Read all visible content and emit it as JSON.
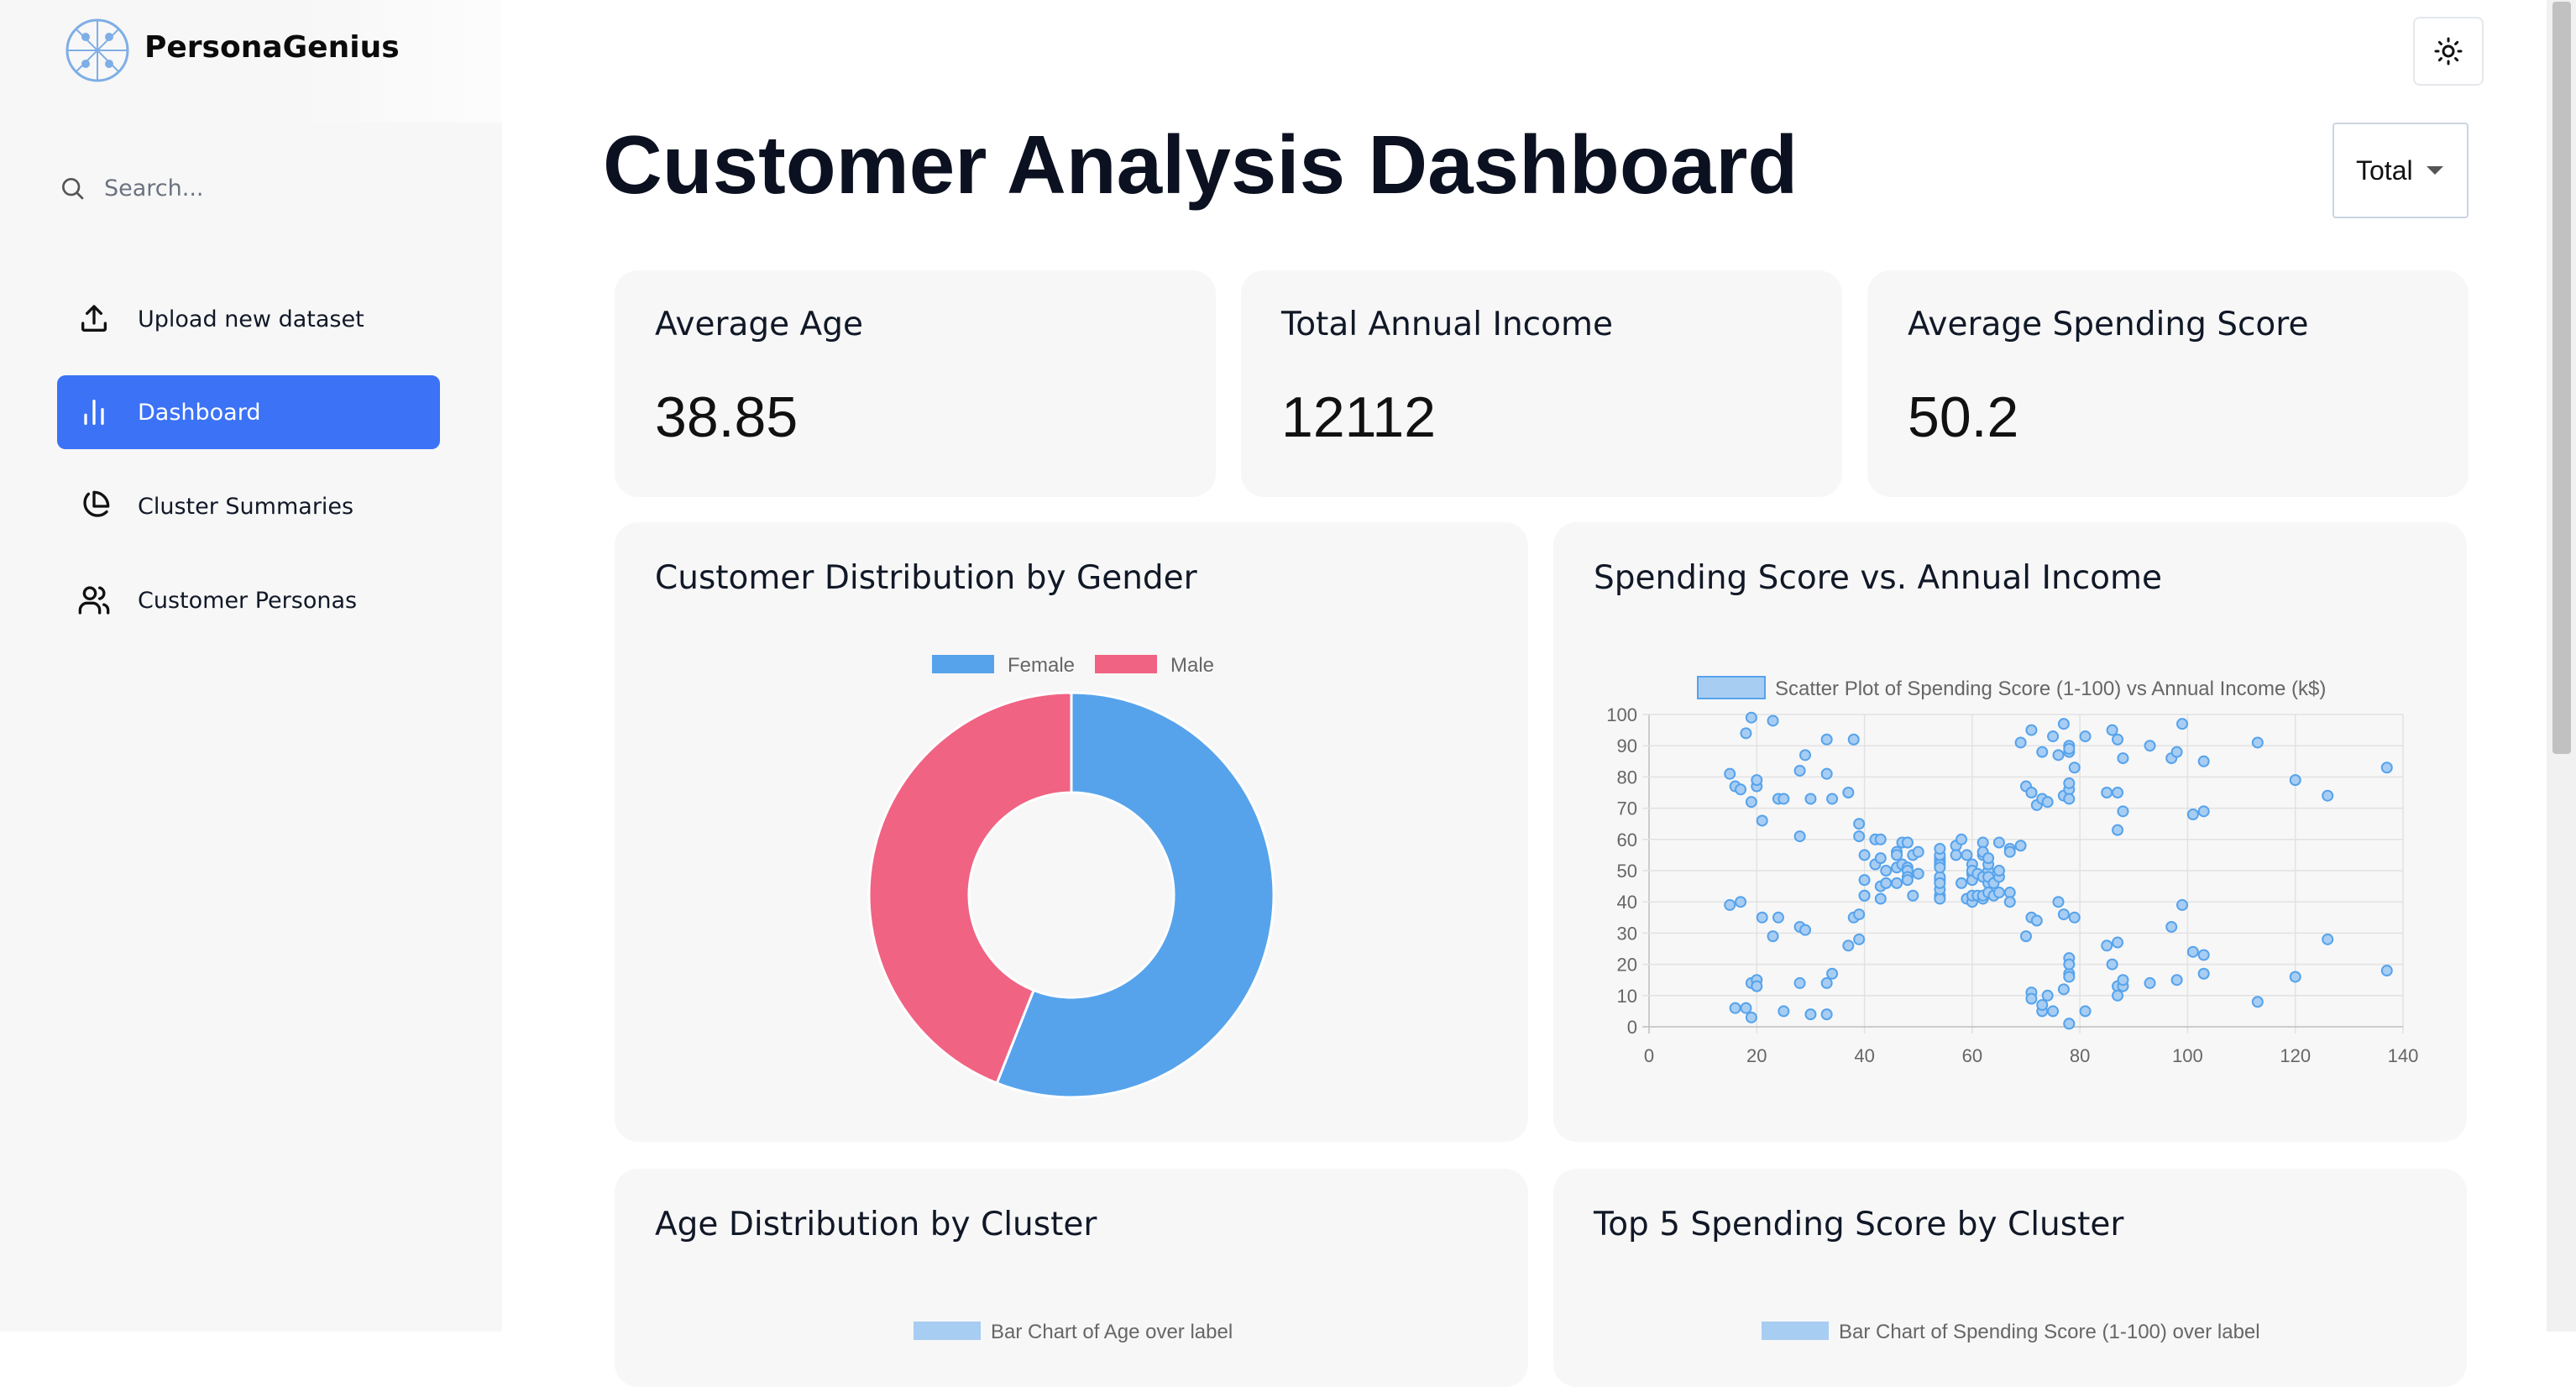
{
  "app": {
    "brand": "PersonaGenius"
  },
  "search": {
    "placeholder": "Search..."
  },
  "sidebar": {
    "items": [
      {
        "label": "Upload new dataset",
        "icon": "upload-icon"
      },
      {
        "label": "Dashboard",
        "icon": "bar-chart-icon",
        "active": true
      },
      {
        "label": "Cluster Summaries",
        "icon": "pie-chart-icon"
      },
      {
        "label": "Customer Personas",
        "icon": "users-icon"
      }
    ]
  },
  "header": {
    "title": "Customer Analysis Dashboard",
    "filter_value": "Total",
    "theme_icon": "sun-icon"
  },
  "stats": [
    {
      "title": "Average Age",
      "value": "38.85"
    },
    {
      "title": "Total Annual Income",
      "value": "12112"
    },
    {
      "title": "Average Spending Score",
      "value": "50.2"
    }
  ],
  "colors": {
    "accent": "#3b72f6",
    "female": "#56a3ec",
    "male": "#f06383",
    "card": "#f7f7f7"
  },
  "cards": {
    "gender": {
      "title": "Customer Distribution by Gender"
    },
    "scatter": {
      "title": "Spending Score vs. Annual Income"
    },
    "age": {
      "title": "Age Distribution by Cluster",
      "legend": "Bar Chart of Age over label"
    },
    "spending": {
      "title": "Top 5 Spending Score by Cluster",
      "legend": "Bar Chart of Spending Score (1-100) over label"
    }
  },
  "chart_data": [
    {
      "type": "pie",
      "variant": "doughnut",
      "categories": [
        "Female",
        "Male"
      ],
      "values": [
        112,
        88
      ],
      "legend": "top"
    },
    {
      "type": "scatter",
      "series": [
        {
          "name": "Scatter Plot of Spending Score (1-100) vs Annual Income (k$)",
          "points": [
            [
              15,
              39
            ],
            [
              15,
              81
            ],
            [
              16,
              6
            ],
            [
              16,
              77
            ],
            [
              17,
              40
            ],
            [
              17,
              76
            ],
            [
              18,
              6
            ],
            [
              18,
              94
            ],
            [
              19,
              3
            ],
            [
              19,
              72
            ],
            [
              19,
              14
            ],
            [
              19,
              99
            ],
            [
              20,
              15
            ],
            [
              20,
              77
            ],
            [
              20,
              13
            ],
            [
              20,
              79
            ],
            [
              21,
              35
            ],
            [
              21,
              66
            ],
            [
              23,
              29
            ],
            [
              23,
              98
            ],
            [
              24,
              35
            ],
            [
              24,
              73
            ],
            [
              25,
              5
            ],
            [
              25,
              73
            ],
            [
              28,
              14
            ],
            [
              28,
              82
            ],
            [
              28,
              32
            ],
            [
              28,
              61
            ],
            [
              29,
              31
            ],
            [
              29,
              87
            ],
            [
              30,
              4
            ],
            [
              30,
              73
            ],
            [
              33,
              4
            ],
            [
              33,
              92
            ],
            [
              33,
              14
            ],
            [
              33,
              81
            ],
            [
              34,
              17
            ],
            [
              34,
              73
            ],
            [
              37,
              26
            ],
            [
              37,
              75
            ],
            [
              38,
              35
            ],
            [
              38,
              92
            ],
            [
              39,
              36
            ],
            [
              39,
              61
            ],
            [
              39,
              28
            ],
            [
              39,
              65
            ],
            [
              40,
              55
            ],
            [
              40,
              47
            ],
            [
              40,
              42
            ],
            [
              40,
              42
            ],
            [
              42,
              52
            ],
            [
              42,
              60
            ],
            [
              43,
              54
            ],
            [
              43,
              60
            ],
            [
              43,
              45
            ],
            [
              43,
              41
            ],
            [
              44,
              50
            ],
            [
              44,
              46
            ],
            [
              46,
              51
            ],
            [
              46,
              46
            ],
            [
              46,
              56
            ],
            [
              46,
              55
            ],
            [
              47,
              52
            ],
            [
              47,
              59
            ],
            [
              48,
              51
            ],
            [
              48,
              59
            ],
            [
              48,
              50
            ],
            [
              48,
              48
            ],
            [
              48,
              59
            ],
            [
              48,
              47
            ],
            [
              49,
              55
            ],
            [
              49,
              42
            ],
            [
              50,
              49
            ],
            [
              50,
              56
            ],
            [
              54,
              47
            ],
            [
              54,
              54
            ],
            [
              54,
              53
            ],
            [
              54,
              48
            ],
            [
              54,
              52
            ],
            [
              54,
              42
            ],
            [
              54,
              51
            ],
            [
              54,
              55
            ],
            [
              54,
              41
            ],
            [
              54,
              44
            ],
            [
              54,
              57
            ],
            [
              54,
              46
            ],
            [
              57,
              58
            ],
            [
              57,
              55
            ],
            [
              58,
              60
            ],
            [
              58,
              46
            ],
            [
              59,
              55
            ],
            [
              59,
              41
            ],
            [
              60,
              49
            ],
            [
              60,
              40
            ],
            [
              60,
              42
            ],
            [
              60,
              52
            ],
            [
              60,
              47
            ],
            [
              60,
              50
            ],
            [
              61,
              42
            ],
            [
              61,
              49
            ],
            [
              62,
              41
            ],
            [
              62,
              48
            ],
            [
              62,
              59
            ],
            [
              62,
              55
            ],
            [
              62,
              56
            ],
            [
              62,
              42
            ],
            [
              63,
              50
            ],
            [
              63,
              46
            ],
            [
              63,
              43
            ],
            [
              63,
              48
            ],
            [
              63,
              52
            ],
            [
              63,
              54
            ],
            [
              64,
              42
            ],
            [
              64,
              46
            ],
            [
              65,
              48
            ],
            [
              65,
              50
            ],
            [
              65,
              43
            ],
            [
              65,
              59
            ],
            [
              67,
              43
            ],
            [
              67,
              57
            ],
            [
              67,
              56
            ],
            [
              67,
              40
            ],
            [
              69,
              58
            ],
            [
              69,
              91
            ],
            [
              70,
              29
            ],
            [
              70,
              77
            ],
            [
              71,
              35
            ],
            [
              71,
              95
            ],
            [
              71,
              11
            ],
            [
              71,
              75
            ],
            [
              71,
              9
            ],
            [
              71,
              75
            ],
            [
              72,
              34
            ],
            [
              72,
              71
            ],
            [
              73,
              5
            ],
            [
              73,
              88
            ],
            [
              73,
              7
            ],
            [
              73,
              73
            ],
            [
              74,
              10
            ],
            [
              74,
              72
            ],
            [
              75,
              5
            ],
            [
              75,
              93
            ],
            [
              76,
              40
            ],
            [
              76,
              87
            ],
            [
              77,
              12
            ],
            [
              77,
              97
            ],
            [
              77,
              36
            ],
            [
              77,
              74
            ],
            [
              78,
              22
            ],
            [
              78,
              90
            ],
            [
              78,
              17
            ],
            [
              78,
              88
            ],
            [
              78,
              20
            ],
            [
              78,
              76
            ],
            [
              78,
              16
            ],
            [
              78,
              89
            ],
            [
              78,
              1
            ],
            [
              78,
              78
            ],
            [
              78,
              1
            ],
            [
              78,
              73
            ],
            [
              79,
              35
            ],
            [
              79,
              83
            ],
            [
              81,
              5
            ],
            [
              81,
              93
            ],
            [
              85,
              26
            ],
            [
              85,
              75
            ],
            [
              86,
              20
            ],
            [
              86,
              95
            ],
            [
              87,
              27
            ],
            [
              87,
              63
            ],
            [
              87,
              13
            ],
            [
              87,
              75
            ],
            [
              87,
              10
            ],
            [
              87,
              92
            ],
            [
              88,
              13
            ],
            [
              88,
              86
            ],
            [
              88,
              15
            ],
            [
              88,
              69
            ],
            [
              93,
              14
            ],
            [
              93,
              90
            ],
            [
              97,
              32
            ],
            [
              97,
              86
            ],
            [
              98,
              15
            ],
            [
              98,
              88
            ],
            [
              99,
              39
            ],
            [
              99,
              97
            ],
            [
              101,
              24
            ],
            [
              101,
              68
            ],
            [
              103,
              17
            ],
            [
              103,
              85
            ],
            [
              103,
              23
            ],
            [
              103,
              69
            ],
            [
              113,
              8
            ],
            [
              113,
              91
            ],
            [
              120,
              16
            ],
            [
              120,
              79
            ],
            [
              126,
              28
            ],
            [
              126,
              74
            ],
            [
              137,
              18
            ],
            [
              137,
              83
            ]
          ]
        }
      ],
      "xlim": [
        0,
        140
      ],
      "ylim": [
        0,
        100
      ],
      "xticks": [
        0,
        20,
        40,
        60,
        80,
        100,
        120,
        140
      ],
      "yticks": [
        0,
        10,
        20,
        30,
        40,
        50,
        60,
        70,
        80,
        90,
        100
      ],
      "grid": true,
      "legend": "top"
    }
  ]
}
